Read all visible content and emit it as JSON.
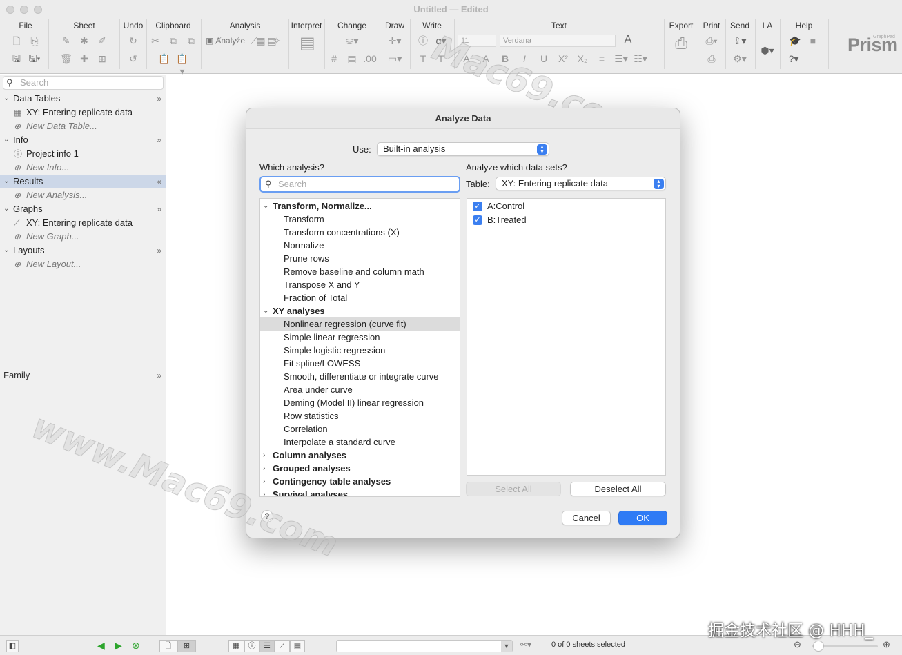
{
  "window": {
    "title": "Untitled — Edited"
  },
  "toolbar": {
    "groups": [
      "File",
      "Sheet",
      "Undo",
      "Clipboard",
      "Analysis",
      "Interpret",
      "Change",
      "Draw",
      "Write",
      "Text",
      "Export",
      "Print",
      "Send",
      "LA",
      "Help"
    ],
    "analyze_label": "Analyze",
    "font_size": "11",
    "font_name": "Verdana",
    "logo": "Prism",
    "logo_small": "GraphPad"
  },
  "sidebar": {
    "search_placeholder": "Search",
    "sections": {
      "data_tables": {
        "label": "Data Tables",
        "item": "XY: Entering replicate data",
        "new": "New Data Table..."
      },
      "info": {
        "label": "Info",
        "item": "Project info 1",
        "new": "New Info..."
      },
      "results": {
        "label": "Results",
        "new": "New Analysis..."
      },
      "graphs": {
        "label": "Graphs",
        "item": "XY: Entering replicate data",
        "new": "New Graph..."
      },
      "layouts": {
        "label": "Layouts",
        "new": "New Layout..."
      }
    },
    "family_label": "Family"
  },
  "dialog": {
    "title": "Analyze Data",
    "use_label": "Use:",
    "use_value": "Built-in analysis",
    "which_analysis_label": "Which analysis?",
    "search_placeholder": "Search",
    "analyze_sets_label": "Analyze which data sets?",
    "table_label": "Table:",
    "table_value": "XY: Entering replicate data",
    "analyses": [
      {
        "text": "Transform, Normalize...",
        "kind": "cat",
        "open": true
      },
      {
        "text": "Transform",
        "kind": "sub"
      },
      {
        "text": "Transform concentrations (X)",
        "kind": "sub"
      },
      {
        "text": "Normalize",
        "kind": "sub"
      },
      {
        "text": "Prune rows",
        "kind": "sub"
      },
      {
        "text": "Remove baseline and column math",
        "kind": "sub"
      },
      {
        "text": "Transpose X and Y",
        "kind": "sub"
      },
      {
        "text": "Fraction of Total",
        "kind": "sub"
      },
      {
        "text": "XY analyses",
        "kind": "cat",
        "open": true
      },
      {
        "text": "Nonlinear regression (curve fit)",
        "kind": "sub",
        "selected": true
      },
      {
        "text": "Simple linear regression",
        "kind": "sub"
      },
      {
        "text": "Simple logistic regression",
        "kind": "sub"
      },
      {
        "text": "Fit spline/LOWESS",
        "kind": "sub"
      },
      {
        "text": "Smooth, differentiate or integrate curve",
        "kind": "sub"
      },
      {
        "text": "Area under curve",
        "kind": "sub"
      },
      {
        "text": "Deming (Model II) linear regression",
        "kind": "sub"
      },
      {
        "text": "Row statistics",
        "kind": "sub"
      },
      {
        "text": "Correlation",
        "kind": "sub"
      },
      {
        "text": "Interpolate a standard curve",
        "kind": "sub"
      },
      {
        "text": "Column analyses",
        "kind": "cat",
        "open": false
      },
      {
        "text": "Grouped analyses",
        "kind": "cat",
        "open": false
      },
      {
        "text": "Contingency table analyses",
        "kind": "cat",
        "open": false
      },
      {
        "text": "Survival analyses",
        "kind": "cat",
        "open": false
      }
    ],
    "datasets": [
      {
        "label": "A:Control",
        "checked": true
      },
      {
        "label": "B:Treated",
        "checked": true
      }
    ],
    "select_all": "Select All",
    "deselect_all": "Deselect All",
    "help": "?",
    "cancel": "Cancel",
    "ok": "OK"
  },
  "statusbar": {
    "sheets_selected": "0 of 0 sheets selected"
  },
  "watermarks": {
    "top": "Mac69.com",
    "bottom": "www.Mac69.com",
    "corner": "掘金技术社区 @ HHH_"
  },
  "colors": {
    "accent": "#2f7bf5",
    "selection": "#ccd7e8"
  }
}
